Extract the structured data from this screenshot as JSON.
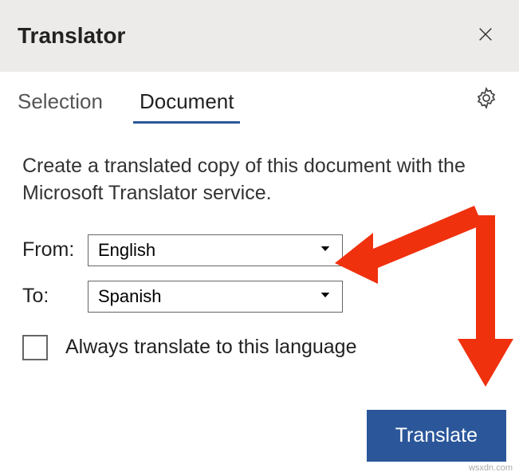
{
  "header": {
    "title": "Translator"
  },
  "tabs": {
    "selection": "Selection",
    "document": "Document"
  },
  "description": "Create a translated copy of this document with the Microsoft Translator service.",
  "from": {
    "label": "From:",
    "value": "English"
  },
  "to": {
    "label": "To:",
    "value": "Spanish"
  },
  "always_translate": {
    "label": "Always translate to this language",
    "checked": false
  },
  "translate_button": "Translate",
  "watermark": "wsxdn.com"
}
